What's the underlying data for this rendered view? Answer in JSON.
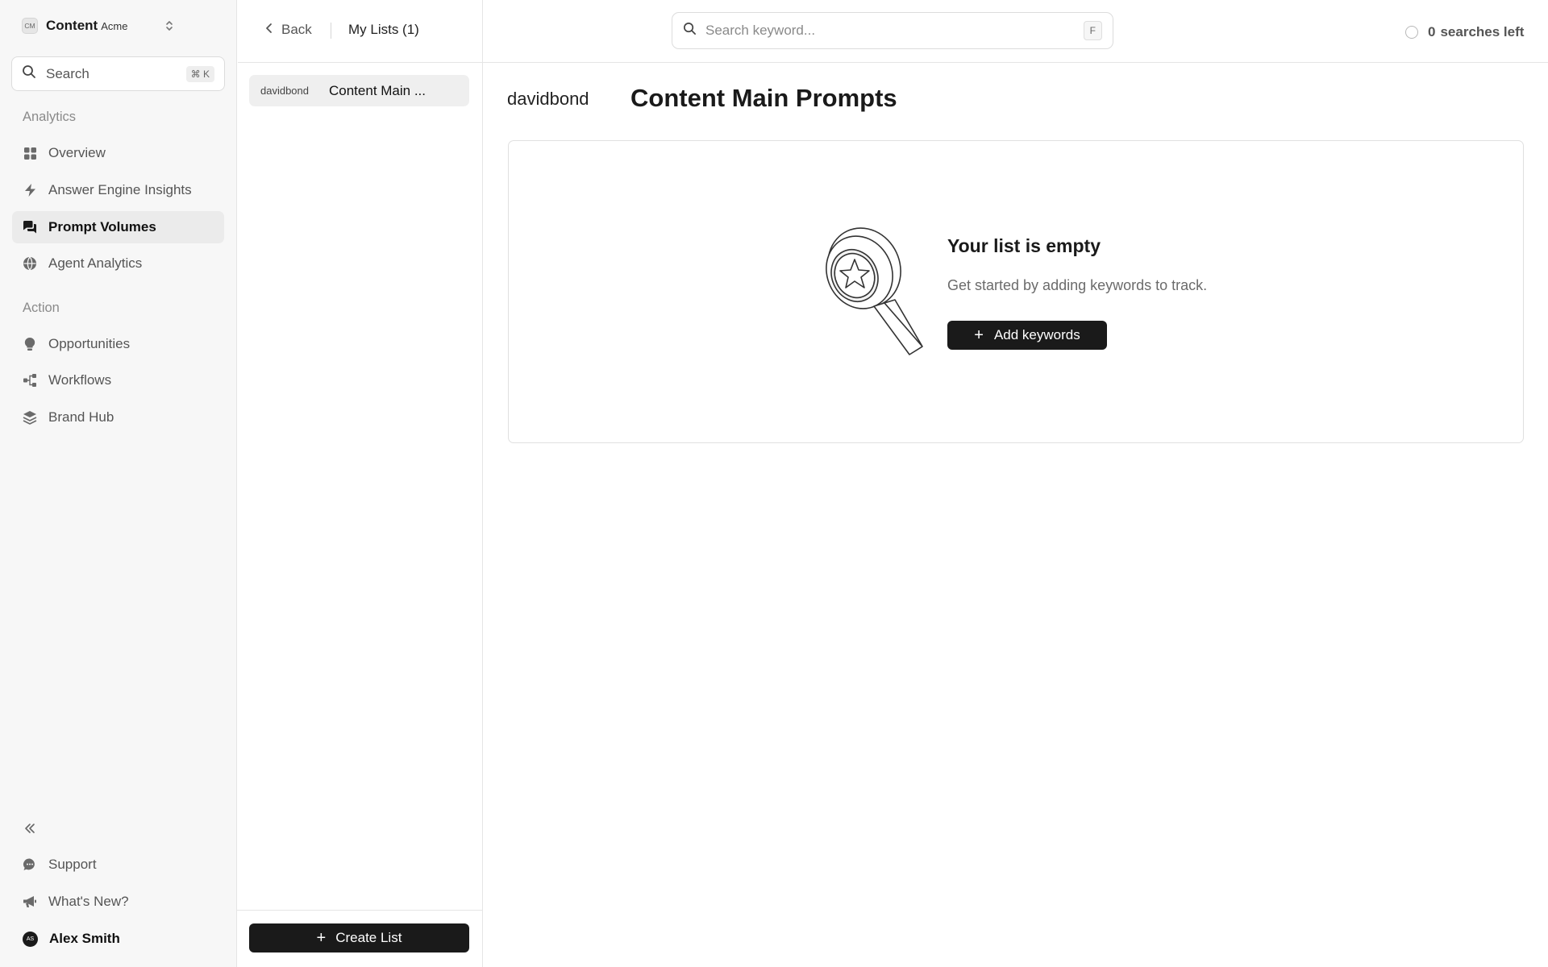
{
  "workspace": {
    "badge": "CM",
    "name": "Content",
    "org": "Acme"
  },
  "sidebar": {
    "search_label": "Search",
    "search_shortcut": "⌘ K",
    "sections": [
      {
        "label": "Analytics",
        "items": [
          {
            "label": "Overview",
            "icon": "grid-icon"
          },
          {
            "label": "Answer Engine Insights",
            "icon": "lightning-icon"
          },
          {
            "label": "Prompt Volumes",
            "icon": "chat-bubbles-icon",
            "active": true
          },
          {
            "label": "Agent Analytics",
            "icon": "globe-icon"
          }
        ]
      },
      {
        "label": "Action",
        "items": [
          {
            "label": "Opportunities",
            "icon": "lightbulb-icon"
          },
          {
            "label": "Workflows",
            "icon": "workflow-icon"
          },
          {
            "label": "Brand Hub",
            "icon": "layers-icon"
          }
        ]
      }
    ],
    "footer": [
      {
        "label": "Support",
        "icon": "chat-icon"
      },
      {
        "label": "What's New?",
        "icon": "megaphone-icon"
      },
      {
        "label": "Alex Smith",
        "icon": "avatar",
        "avatar_initials": "AS"
      }
    ]
  },
  "header": {
    "back_label": "Back",
    "my_lists_label": "My Lists (1)",
    "search_placeholder": "Search keyword...",
    "search_shortcut": "F",
    "searches_left_count": "0",
    "searches_left_label": "searches left"
  },
  "lists": [
    {
      "owner": "davidbond",
      "name": "Content Main ..."
    }
  ],
  "create_list_label": "Create List",
  "detail": {
    "owner": "davidbond",
    "title": "Content Main Prompts",
    "empty_title": "Your list is empty",
    "empty_subtitle": "Get started by adding keywords to track.",
    "add_keywords_label": "Add keywords"
  }
}
